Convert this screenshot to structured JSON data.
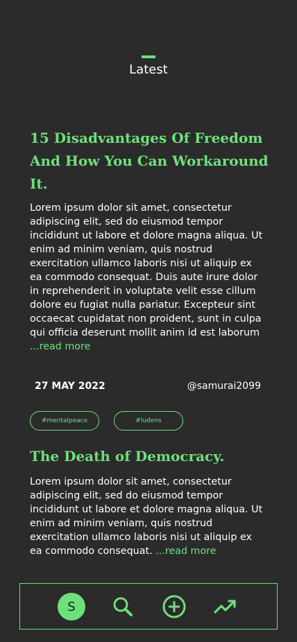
{
  "header": {
    "title": "Latest"
  },
  "posts": [
    {
      "title": "15 Disadvantages Of Freedom And How You Can Workaround It.",
      "body": "Lorem ipsum dolor sit amet, consectetur adipiscing elit, sed do eiusmod tempor incididunt ut labore et dolore magna aliqua. Ut enim ad minim veniam, quis nostrud exercitation ullamco laboris nisi ut aliquip ex ea commodo consequat. Duis aute irure dolor in reprehenderit in voluptate velit esse cillum dolore eu fugiat nulla pariatur. Excepteur sint occaecat cupidatat non proident, sunt in culpa qui officia deserunt mollit anim id est laborum",
      "read_more": "...read more",
      "date": "27 MAY 2022",
      "author": "@samurai2099",
      "tags": [
        "#mentalpeace",
        "#ludens"
      ]
    },
    {
      "title": "The Death of Democracy.",
      "body": "Lorem ipsum dolor sit amet, consectetur adipiscing elit, sed do eiusmod tempor incididunt ut labore et dolore magna aliqua. Ut enim ad minim veniam, quis nostrud exercitation ullamco laboris nisi ut aliquip ex ea commodo consequat. ",
      "read_more": "...read more"
    }
  ],
  "nav": {
    "avatar_initial": "S",
    "icons": [
      "profile-icon",
      "search-icon",
      "add-icon",
      "trending-icon"
    ]
  },
  "colors": {
    "accent": "#6ee07b",
    "background": "#2b2b2b",
    "text": "#ffffff"
  }
}
